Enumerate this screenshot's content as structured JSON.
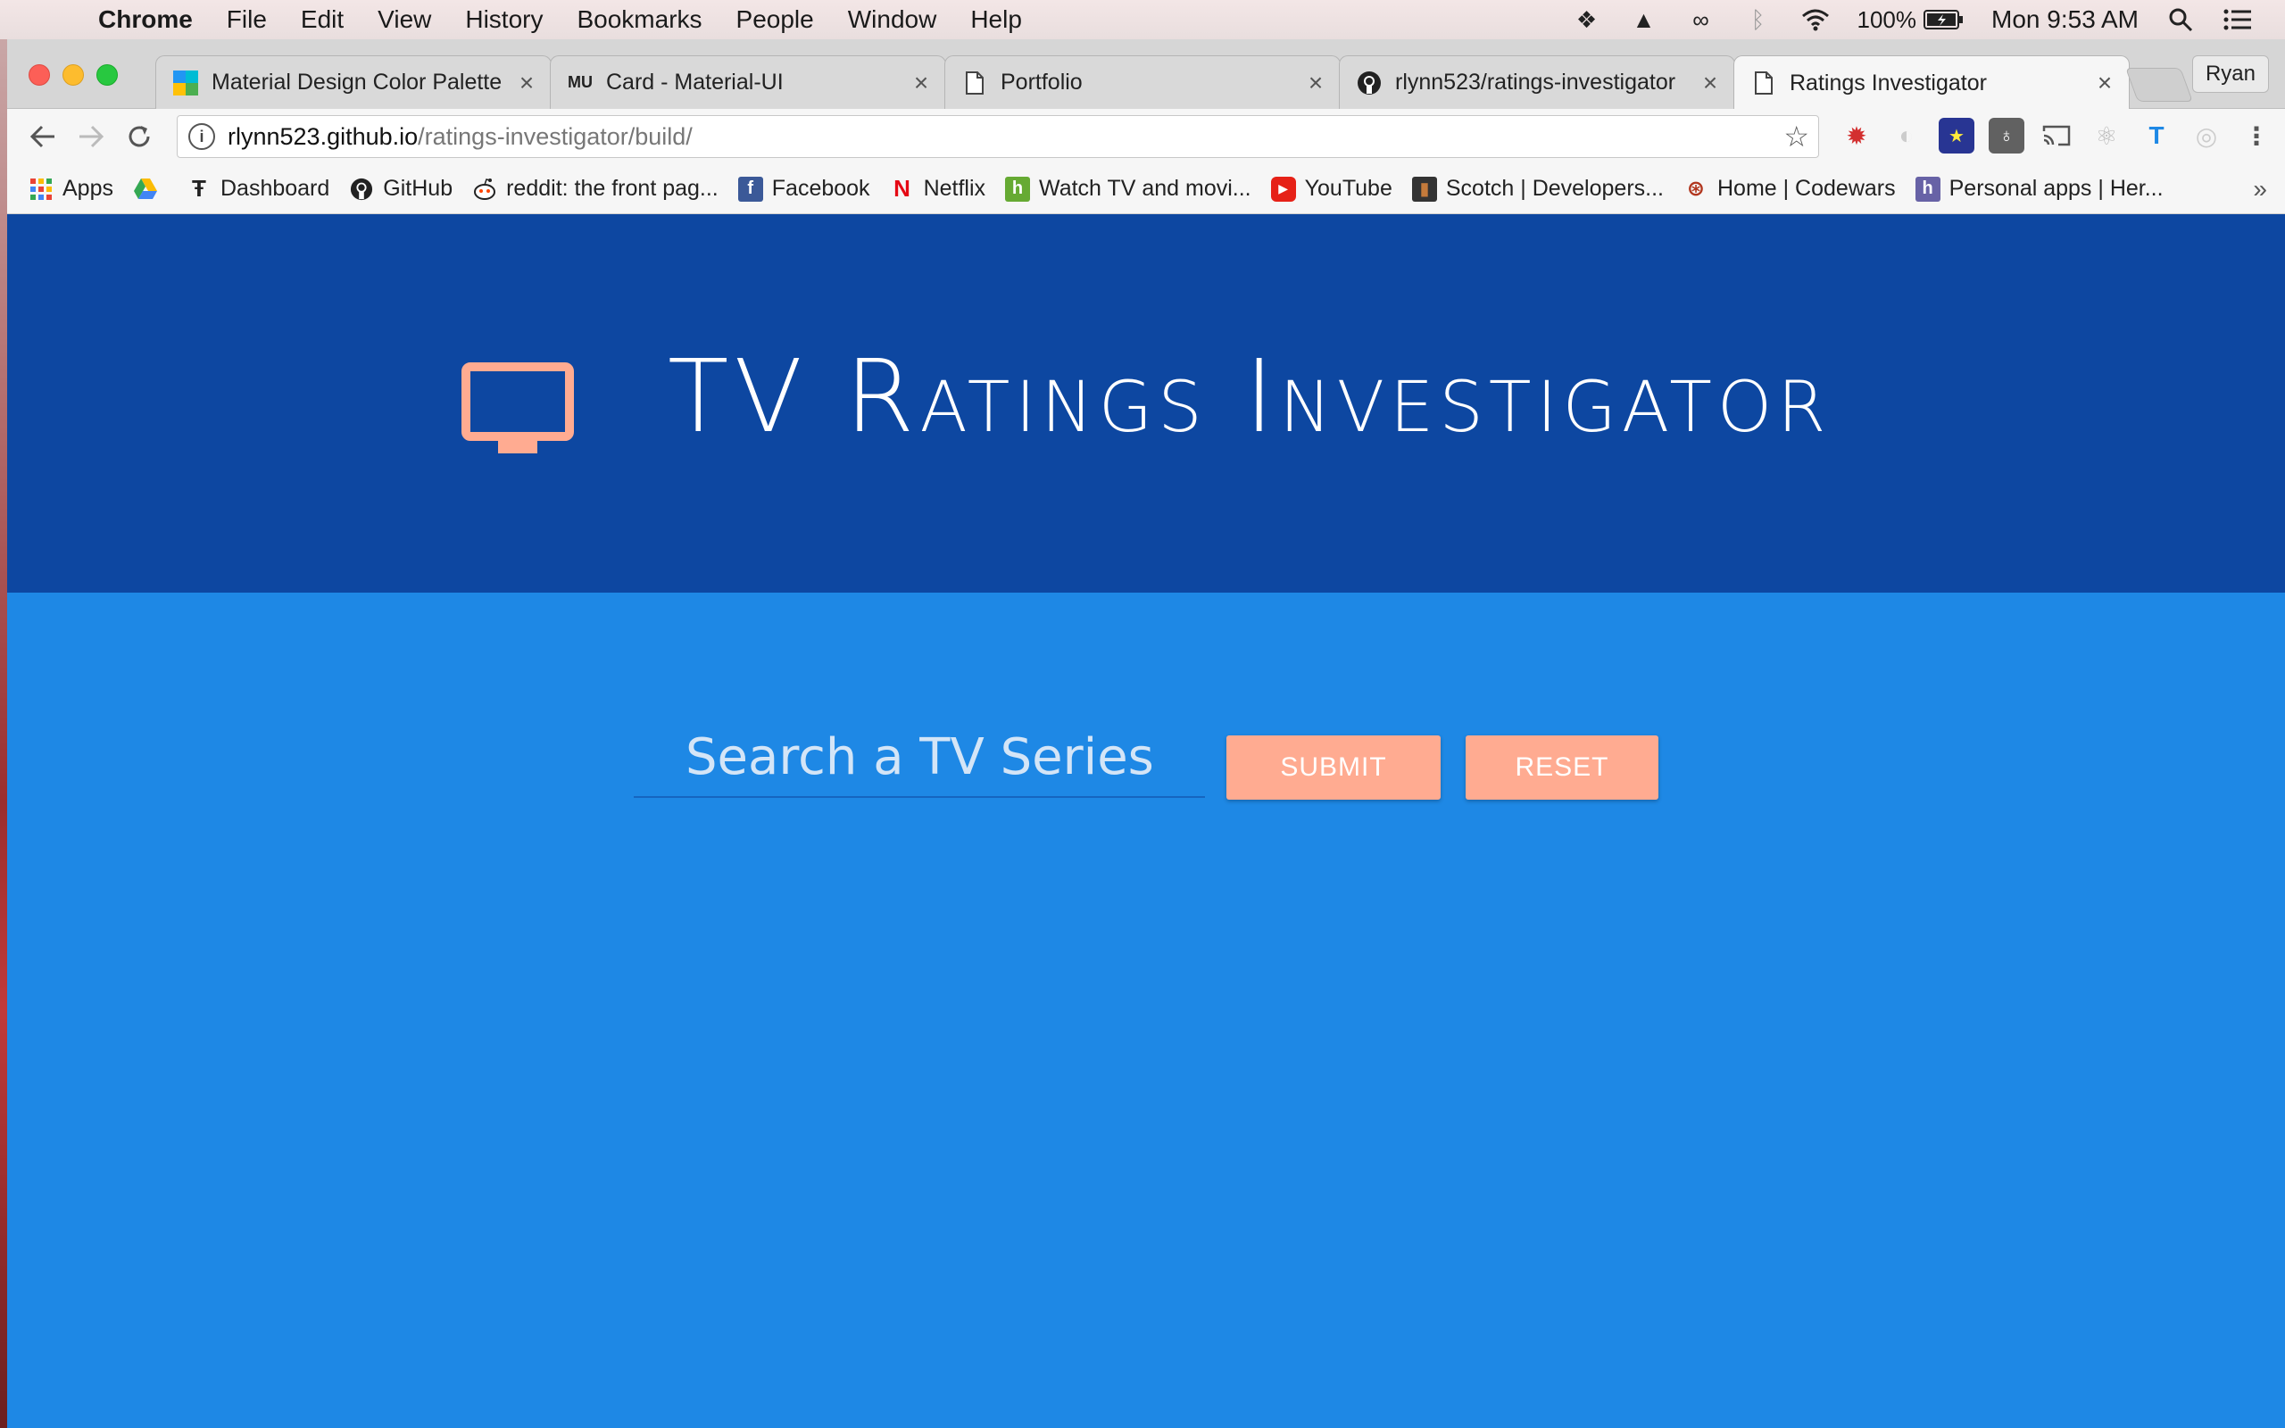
{
  "menubar": {
    "app": "Chrome",
    "items": [
      "File",
      "Edit",
      "View",
      "History",
      "Bookmarks",
      "People",
      "Window",
      "Help"
    ],
    "battery": "100%",
    "clock": "Mon 9:53 AM"
  },
  "tabs": [
    {
      "title": "Material Design Color Palette",
      "favicon": "palette-icon"
    },
    {
      "title": "Card - Material-UI",
      "favicon": "material-ui-icon"
    },
    {
      "title": "Portfolio",
      "favicon": "page-icon"
    },
    {
      "title": "rlynn523/ratings-investigator",
      "favicon": "github-icon"
    },
    {
      "title": "Ratings Investigator",
      "favicon": "page-icon"
    }
  ],
  "profile": "Ryan",
  "address": {
    "host": "rlynn523.github.io",
    "path": "/ratings-investigator/build/"
  },
  "bookmarks": [
    {
      "label": "Apps"
    },
    {
      "label": ""
    },
    {
      "label": "Dashboard"
    },
    {
      "label": "GitHub"
    },
    {
      "label": "reddit: the front pag..."
    },
    {
      "label": "Facebook"
    },
    {
      "label": "Netflix"
    },
    {
      "label": "Watch TV and movi..."
    },
    {
      "label": "YouTube"
    },
    {
      "label": "Scotch | Developers..."
    },
    {
      "label": "Home | Codewars"
    },
    {
      "label": "Personal apps | Her..."
    }
  ],
  "bookmarks_overflow": "»",
  "page": {
    "title": "TV Ratings Investigator",
    "search_placeholder": "Search a TV Series",
    "submit_label": "SUBMIT",
    "reset_label": "RESET"
  },
  "colors": {
    "hero_bg": "#0d47a1",
    "page_bg": "#1e88e5",
    "accent": "#ffab91"
  }
}
